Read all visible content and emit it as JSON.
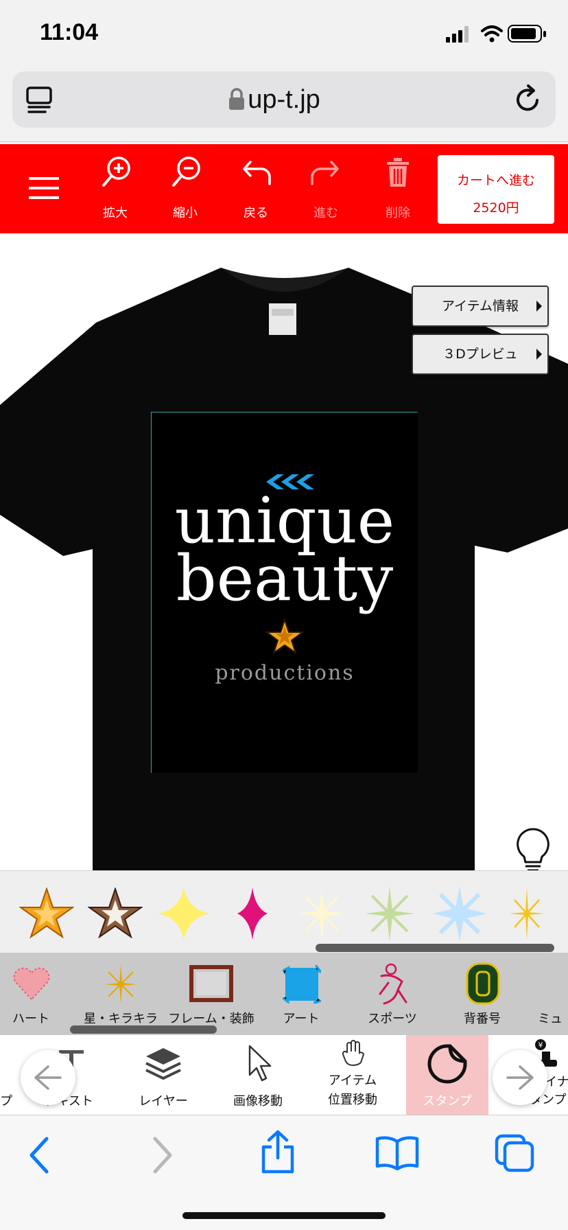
{
  "status_bar": {
    "time": "11:04"
  },
  "browser": {
    "url": "up-t.jp"
  },
  "toolbar": {
    "zoom_in": "拡大",
    "zoom_out": "縮小",
    "undo": "戻る",
    "redo": "進む",
    "delete": "削除",
    "cart_label": "カートへ進む",
    "cart_price": "2520円"
  },
  "side_buttons": {
    "item_info": "アイテム情報",
    "preview_3d": "３Dプレビュ"
  },
  "design": {
    "line1": "unique",
    "line2": "beauty",
    "line3": "productions"
  },
  "categories": [
    {
      "label": "ハート"
    },
    {
      "label": "星・キラキラ"
    },
    {
      "label": "フレーム・装飾"
    },
    {
      "label": "アート"
    },
    {
      "label": "スポーツ"
    },
    {
      "label": "背番号"
    },
    {
      "label": "ミュ"
    }
  ],
  "tools": [
    {
      "label": "プ"
    },
    {
      "label": "テキスト"
    },
    {
      "label": "レイヤー"
    },
    {
      "label": "画像移動"
    },
    {
      "label": "アイテム",
      "label2": "位置移動"
    },
    {
      "label": "スタンプ"
    },
    {
      "label": "デザイナー",
      "label2": "スタンプ"
    }
  ],
  "colors": {
    "brand_red": "#ff0000",
    "shirt": "#0a0a0a",
    "safari_blue": "#0a7aff",
    "stamp_active": "#f6c4c4"
  }
}
